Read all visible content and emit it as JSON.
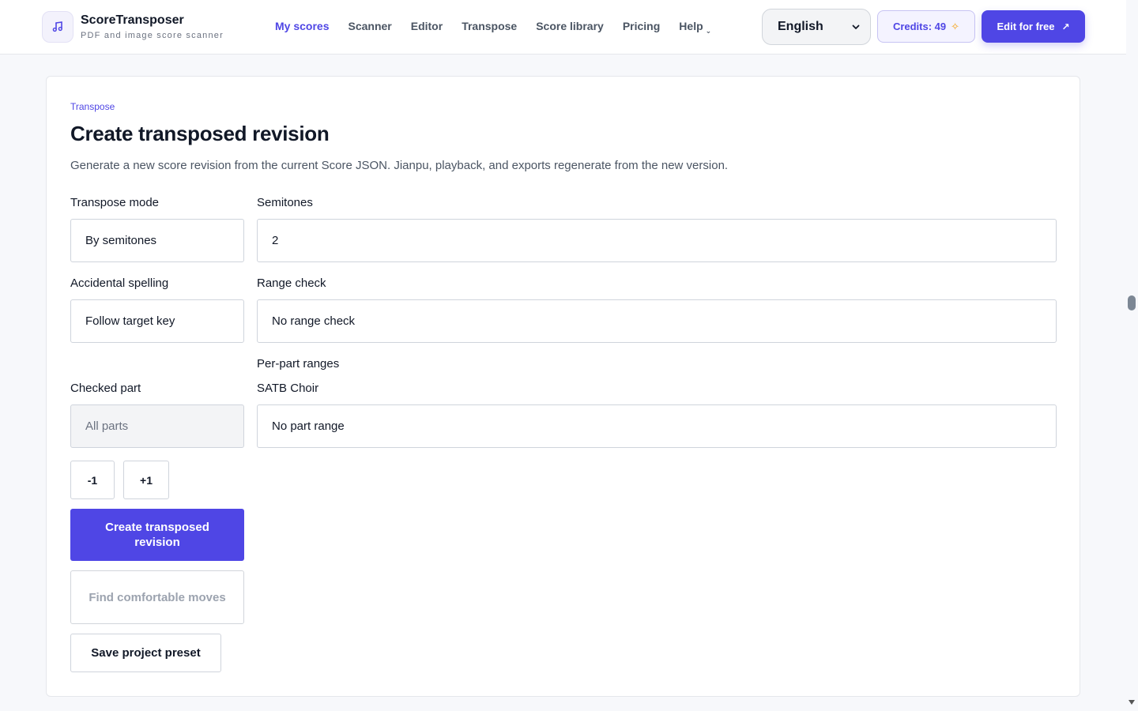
{
  "brand": {
    "name": "ScoreTransposer",
    "tagline": "PDF and image score scanner"
  },
  "nav": {
    "items": [
      {
        "label": "My scores",
        "active": true
      },
      {
        "label": "Scanner"
      },
      {
        "label": "Editor"
      },
      {
        "label": "Transpose"
      },
      {
        "label": "Score library"
      },
      {
        "label": "Pricing"
      },
      {
        "label": "Help"
      }
    ]
  },
  "header": {
    "language": "English",
    "credits": "Credits: 49",
    "edit_label": "Edit for free"
  },
  "page": {
    "breadcrumb": "Transpose",
    "title": "Create transposed revision",
    "description": "Generate a new score revision from the current Score JSON. Jianpu, playback, and exports regenerate from the new version."
  },
  "form": {
    "transpose_mode": {
      "label": "Transpose mode",
      "value": "By semitones"
    },
    "semitones": {
      "label": "Semitones",
      "value": "2"
    },
    "accidental_spelling": {
      "label": "Accidental spelling",
      "value": "Follow target key"
    },
    "range_check": {
      "label": "Range check",
      "value": "No range check"
    },
    "per_part_ranges": {
      "label": "Per-part ranges"
    },
    "checked_part": {
      "label": "Checked part",
      "value": "All parts"
    },
    "satb": {
      "label": "SATB Choir",
      "value": "No part range"
    }
  },
  "actions": {
    "minus": "-1",
    "plus": "+1",
    "create": "Create transposed revision",
    "find": "Find comfortable moves",
    "save": "Save project preset"
  },
  "colors": {
    "accent": "#4f46e5",
    "credits_star": "#f59e0b"
  }
}
